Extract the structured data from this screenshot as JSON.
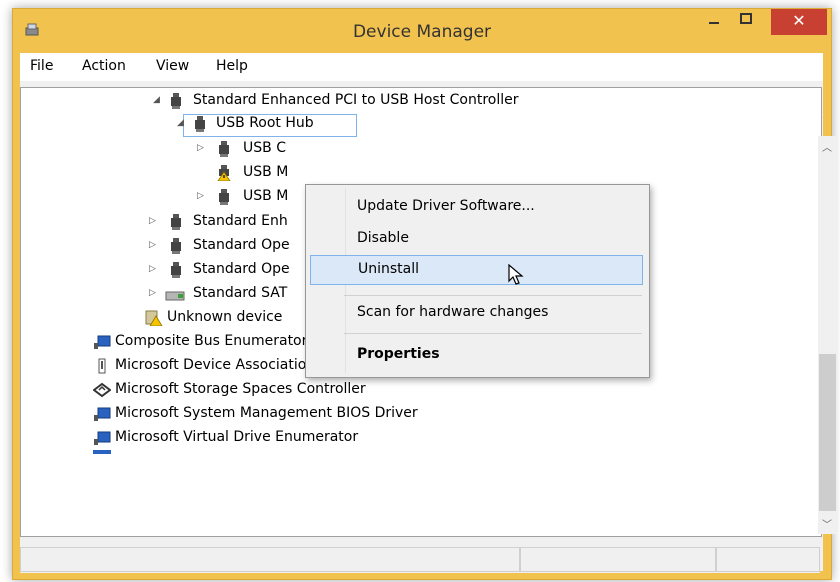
{
  "window": {
    "title": "Device Manager"
  },
  "menu": [
    "File",
    "Action",
    "View",
    "Help"
  ],
  "tree": {
    "rows": [
      {
        "label": "Standard Enhanced PCI to USB Host Controller",
        "expander": "◢",
        "icon": "usb-controller-icon"
      },
      {
        "label": "USB Root Hub",
        "expander": "◢",
        "icon": "usb-controller-icon"
      },
      {
        "label": "USB C",
        "expander": "▷",
        "icon": "usb-controller-icon"
      },
      {
        "label": "USB M",
        "expander": "",
        "icon": "warning-icon"
      },
      {
        "label": "USB M",
        "expander": "▷",
        "icon": "usb-controller-icon"
      },
      {
        "label": "Standard Enh",
        "expander": "▷",
        "icon": "usb-controller-icon"
      },
      {
        "label": "Standard Ope",
        "expander": "▷",
        "icon": "usb-controller-icon"
      },
      {
        "label": "Standard Ope",
        "expander": "▷",
        "icon": "usb-controller-icon"
      },
      {
        "label": "Standard SAT",
        "expander": "▷",
        "icon": "sata-controller-icon"
      },
      {
        "label": "Unknown device",
        "expander": "",
        "icon": "unknown-device-warning-icon"
      },
      {
        "label": "Composite Bus Enumerator",
        "expander": "",
        "icon": "system-device-icon"
      },
      {
        "label": "Microsoft Device Association Root Enumerator",
        "expander": "",
        "icon": "usb-plug-icon"
      },
      {
        "label": "Microsoft Storage Spaces Controller",
        "expander": "",
        "icon": "storage-icon"
      },
      {
        "label": "Microsoft System Management BIOS Driver",
        "expander": "",
        "icon": "system-device-icon"
      },
      {
        "label": "Microsoft Virtual Drive Enumerator",
        "expander": "",
        "icon": "system-device-icon"
      }
    ]
  },
  "context_menu": {
    "items": [
      "Update Driver Software...",
      "Disable",
      "Uninstall",
      "Scan for hardware changes",
      "Properties"
    ],
    "highlighted": "Uninstall"
  },
  "colors": {
    "title_bar": "#f2c24f",
    "close_button": "#c84031",
    "selection_border": "#7eb4ea",
    "menu_hover": "#dbe8f7"
  }
}
